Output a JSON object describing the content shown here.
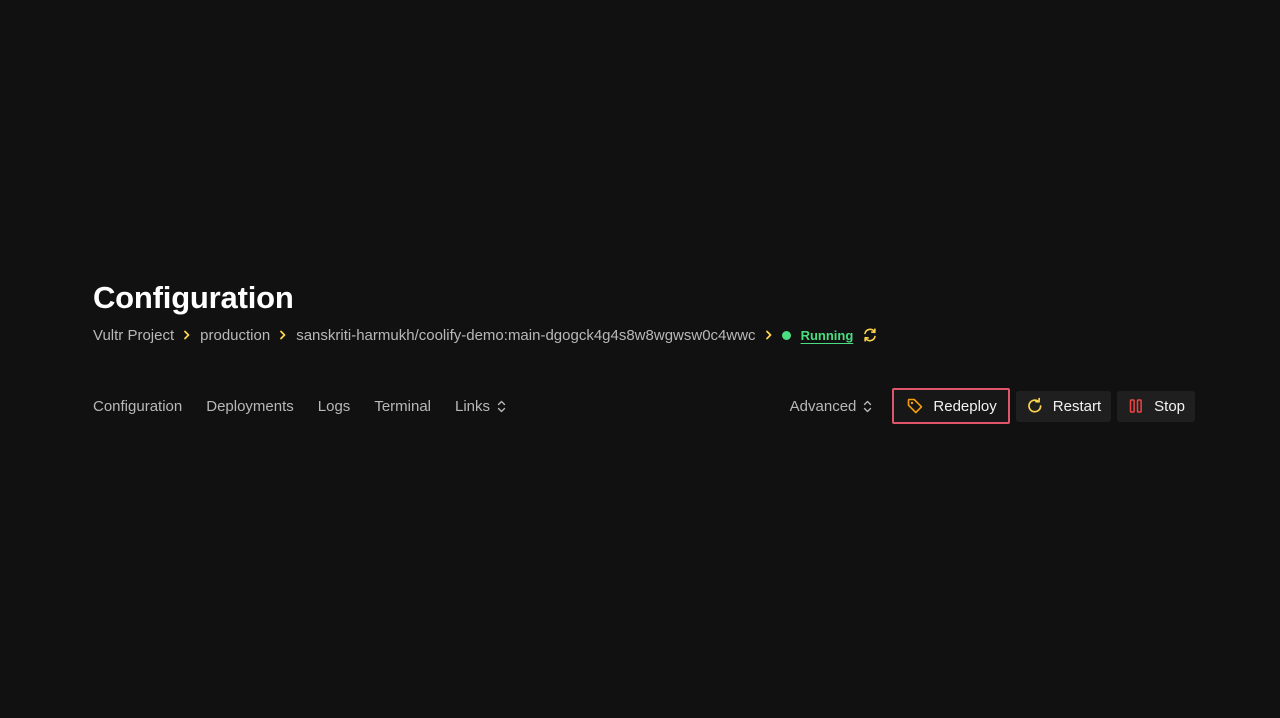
{
  "page": {
    "title": "Configuration"
  },
  "breadcrumb": {
    "items": [
      "Vultr Project",
      "production",
      "sanskriti-harmukh/coolify-demo:main-dgogck4g4s8w8wgwsw0c4wwc"
    ],
    "status": "Running"
  },
  "tabs": [
    "Configuration",
    "Deployments",
    "Logs",
    "Terminal",
    "Links"
  ],
  "actions": {
    "advanced_label": "Advanced",
    "redeploy_label": "Redeploy",
    "restart_label": "Restart",
    "stop_label": "Stop"
  },
  "icons": {
    "breadcrumb_separator": "chevron-right-icon",
    "status": "status-dot-icon",
    "refresh": "refresh-icon",
    "dropdown": "chevron-up-down-icon",
    "redeploy": "tag-icon",
    "restart": "restart-icon",
    "stop": "stop-icon"
  },
  "colors": {
    "background": "#111111",
    "accent": "#fcd34d",
    "status_running": "#4ade80",
    "stop": "#ef4444",
    "redeploy_icon": "#f59e0b",
    "highlight_border": "#e05569"
  }
}
